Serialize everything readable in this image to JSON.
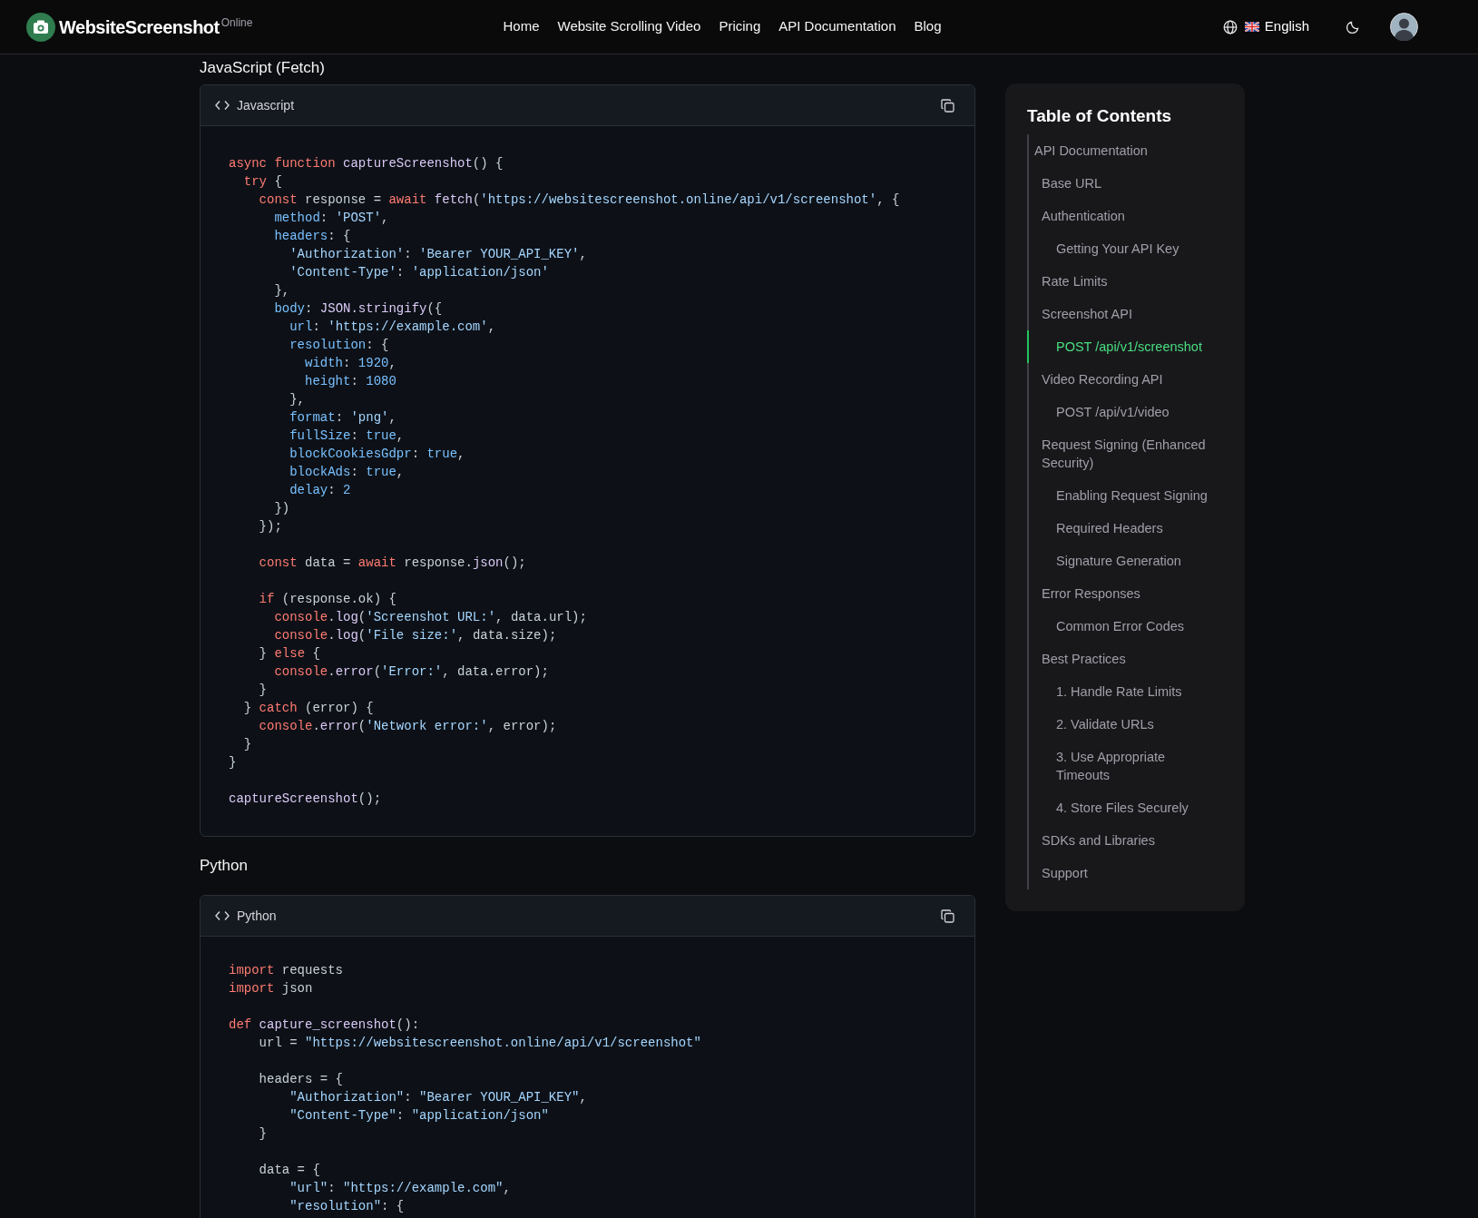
{
  "header": {
    "logo": {
      "name": "WebsiteScreenshot",
      "suffix": "Online"
    },
    "nav": [
      "Home",
      "Website Scrolling Video",
      "Pricing",
      "API Documentation",
      "Blog"
    ],
    "language": "English"
  },
  "sections": [
    {
      "heading": "JavaScript (Fetch)",
      "language": "Javascript",
      "lines": [
        {
          "kind": "code",
          "tokens": [
            {
              "kind": "keyword",
              "text": "async function "
            },
            {
              "kind": "function",
              "text": "captureScreenshot"
            },
            {
              "kind": "plain",
              "text": "() {"
            }
          ]
        },
        {
          "kind": "code",
          "tokens": [
            {
              "kind": "keyword",
              "text": "  try "
            },
            {
              "kind": "plain",
              "text": "{"
            }
          ]
        },
        {
          "kind": "code",
          "tokens": [
            {
              "kind": "keyword",
              "text": "    const "
            },
            {
              "kind": "plain",
              "text": "response = "
            },
            {
              "kind": "keyword",
              "text": "await "
            },
            {
              "kind": "function",
              "text": "fetch"
            },
            {
              "kind": "plain",
              "text": "("
            },
            {
              "kind": "string",
              "text": "'https://websitescreenshot.online/api/v1/screenshot'"
            },
            {
              "kind": "plain",
              "text": ", {"
            }
          ]
        },
        {
          "kind": "code",
          "tokens": [
            {
              "kind": "property",
              "text": "      method"
            },
            {
              "kind": "plain",
              "text": ": "
            },
            {
              "kind": "string",
              "text": "'POST'"
            },
            {
              "kind": "plain",
              "text": ","
            }
          ]
        },
        {
          "kind": "code",
          "tokens": [
            {
              "kind": "property",
              "text": "      headers"
            },
            {
              "kind": "plain",
              "text": ": {"
            }
          ]
        },
        {
          "kind": "code",
          "tokens": [
            {
              "kind": "string",
              "text": "        'Authorization'"
            },
            {
              "kind": "plain",
              "text": ": "
            },
            {
              "kind": "string",
              "text": "'Bearer YOUR_API_KEY'"
            },
            {
              "kind": "plain",
              "text": ","
            }
          ]
        },
        {
          "kind": "code",
          "tokens": [
            {
              "kind": "string",
              "text": "        'Content-Type'"
            },
            {
              "kind": "plain",
              "text": ": "
            },
            {
              "kind": "string",
              "text": "'application/json'"
            }
          ]
        },
        {
          "kind": "code",
          "tokens": [
            {
              "kind": "plain",
              "text": "      },"
            }
          ]
        },
        {
          "kind": "code",
          "tokens": [
            {
              "kind": "property",
              "text": "      body"
            },
            {
              "kind": "plain",
              "text": ": "
            },
            {
              "kind": "function",
              "text": "JSON.stringify"
            },
            {
              "kind": "plain",
              "text": "({"
            }
          ]
        },
        {
          "kind": "code",
          "tokens": [
            {
              "kind": "property",
              "text": "        url"
            },
            {
              "kind": "plain",
              "text": ": "
            },
            {
              "kind": "string",
              "text": "'https://example.com'"
            },
            {
              "kind": "plain",
              "text": ","
            }
          ]
        },
        {
          "kind": "code",
          "tokens": [
            {
              "kind": "property",
              "text": "        resolution"
            },
            {
              "kind": "plain",
              "text": ": {"
            }
          ]
        },
        {
          "kind": "code",
          "tokens": [
            {
              "kind": "property",
              "text": "          width"
            },
            {
              "kind": "plain",
              "text": ": "
            },
            {
              "kind": "number",
              "text": "1920"
            },
            {
              "kind": "plain",
              "text": ","
            }
          ]
        },
        {
          "kind": "code",
          "tokens": [
            {
              "kind": "property",
              "text": "          height"
            },
            {
              "kind": "plain",
              "text": ": "
            },
            {
              "kind": "number",
              "text": "1080"
            }
          ]
        },
        {
          "kind": "code",
          "tokens": [
            {
              "kind": "plain",
              "text": "        },"
            }
          ]
        },
        {
          "kind": "code",
          "tokens": [
            {
              "kind": "property",
              "text": "        format"
            },
            {
              "kind": "plain",
              "text": ": "
            },
            {
              "kind": "string",
              "text": "'png'"
            },
            {
              "kind": "plain",
              "text": ","
            }
          ]
        },
        {
          "kind": "code",
          "tokens": [
            {
              "kind": "property",
              "text": "        fullSize"
            },
            {
              "kind": "plain",
              "text": ": "
            },
            {
              "kind": "number",
              "text": "true"
            },
            {
              "kind": "plain",
              "text": ","
            }
          ]
        },
        {
          "kind": "code",
          "tokens": [
            {
              "kind": "property",
              "text": "        blockCookiesGdpr"
            },
            {
              "kind": "plain",
              "text": ": "
            },
            {
              "kind": "number",
              "text": "true"
            },
            {
              "kind": "plain",
              "text": ","
            }
          ]
        },
        {
          "kind": "code",
          "tokens": [
            {
              "kind": "property",
              "text": "        blockAds"
            },
            {
              "kind": "plain",
              "text": ": "
            },
            {
              "kind": "number",
              "text": "true"
            },
            {
              "kind": "plain",
              "text": ","
            }
          ]
        },
        {
          "kind": "code",
          "tokens": [
            {
              "kind": "property",
              "text": "        delay"
            },
            {
              "kind": "plain",
              "text": ": "
            },
            {
              "kind": "number",
              "text": "2"
            }
          ]
        },
        {
          "kind": "code",
          "tokens": [
            {
              "kind": "plain",
              "text": "      })"
            }
          ]
        },
        {
          "kind": "code",
          "tokens": [
            {
              "kind": "plain",
              "text": "    });"
            }
          ]
        },
        {
          "kind": "blank"
        },
        {
          "kind": "code",
          "tokens": [
            {
              "kind": "keyword",
              "text": "    const "
            },
            {
              "kind": "plain",
              "text": "data = "
            },
            {
              "kind": "keyword",
              "text": "await "
            },
            {
              "kind": "plain",
              "text": "response."
            },
            {
              "kind": "function",
              "text": "json"
            },
            {
              "kind": "plain",
              "text": "();"
            }
          ]
        },
        {
          "kind": "blank"
        },
        {
          "kind": "code",
          "tokens": [
            {
              "kind": "keyword",
              "text": "    if "
            },
            {
              "kind": "plain",
              "text": "(response.ok) {"
            }
          ]
        },
        {
          "kind": "code",
          "tokens": [
            {
              "kind": "keyword",
              "text": "      console"
            },
            {
              "kind": "plain",
              "text": "."
            },
            {
              "kind": "function",
              "text": "log"
            },
            {
              "kind": "plain",
              "text": "("
            },
            {
              "kind": "string",
              "text": "'Screenshot URL:'"
            },
            {
              "kind": "plain",
              "text": ", data.url);"
            }
          ]
        },
        {
          "kind": "code",
          "tokens": [
            {
              "kind": "keyword",
              "text": "      console"
            },
            {
              "kind": "plain",
              "text": "."
            },
            {
              "kind": "function",
              "text": "log"
            },
            {
              "kind": "plain",
              "text": "("
            },
            {
              "kind": "string",
              "text": "'File size:'"
            },
            {
              "kind": "plain",
              "text": ", data.size);"
            }
          ]
        },
        {
          "kind": "code",
          "tokens": [
            {
              "kind": "plain",
              "text": "    } "
            },
            {
              "kind": "keyword",
              "text": "else "
            },
            {
              "kind": "plain",
              "text": "{"
            }
          ]
        },
        {
          "kind": "code",
          "tokens": [
            {
              "kind": "keyword",
              "text": "      console"
            },
            {
              "kind": "plain",
              "text": "."
            },
            {
              "kind": "function",
              "text": "error"
            },
            {
              "kind": "plain",
              "text": "("
            },
            {
              "kind": "string",
              "text": "'Error:'"
            },
            {
              "kind": "plain",
              "text": ", data.error);"
            }
          ]
        },
        {
          "kind": "code",
          "tokens": [
            {
              "kind": "plain",
              "text": "    }"
            }
          ]
        },
        {
          "kind": "code",
          "tokens": [
            {
              "kind": "plain",
              "text": "  } "
            },
            {
              "kind": "keyword",
              "text": "catch "
            },
            {
              "kind": "plain",
              "text": "(error) {"
            }
          ]
        },
        {
          "kind": "code",
          "tokens": [
            {
              "kind": "keyword",
              "text": "    console"
            },
            {
              "kind": "plain",
              "text": "."
            },
            {
              "kind": "function",
              "text": "error"
            },
            {
              "kind": "plain",
              "text": "("
            },
            {
              "kind": "string",
              "text": "'Network error:'"
            },
            {
              "kind": "plain",
              "text": ", error);"
            }
          ]
        },
        {
          "kind": "code",
          "tokens": [
            {
              "kind": "plain",
              "text": "  }"
            }
          ]
        },
        {
          "kind": "code",
          "tokens": [
            {
              "kind": "plain",
              "text": "}"
            }
          ]
        },
        {
          "kind": "blank"
        },
        {
          "kind": "code",
          "tokens": [
            {
              "kind": "function",
              "text": "captureScreenshot"
            },
            {
              "kind": "plain",
              "text": "();"
            }
          ]
        }
      ]
    },
    {
      "heading": "Python",
      "language": "Python",
      "lines": [
        {
          "kind": "code",
          "tokens": [
            {
              "kind": "keyword",
              "text": "import "
            },
            {
              "kind": "plain",
              "text": "requests"
            }
          ]
        },
        {
          "kind": "code",
          "tokens": [
            {
              "kind": "keyword",
              "text": "import "
            },
            {
              "kind": "plain",
              "text": "json"
            }
          ]
        },
        {
          "kind": "blank"
        },
        {
          "kind": "code",
          "tokens": [
            {
              "kind": "keyword",
              "text": "def "
            },
            {
              "kind": "function",
              "text": "capture_screenshot"
            },
            {
              "kind": "plain",
              "text": "():"
            }
          ]
        },
        {
          "kind": "code",
          "tokens": [
            {
              "kind": "plain",
              "text": "    url = "
            },
            {
              "kind": "string",
              "text": "\"https://websitescreenshot.online/api/v1/screenshot\""
            }
          ]
        },
        {
          "kind": "blank"
        },
        {
          "kind": "code",
          "tokens": [
            {
              "kind": "plain",
              "text": "    headers = {"
            }
          ]
        },
        {
          "kind": "code",
          "tokens": [
            {
              "kind": "string",
              "text": "        \"Authorization\""
            },
            {
              "kind": "plain",
              "text": ": "
            },
            {
              "kind": "string",
              "text": "\"Bearer YOUR_API_KEY\""
            },
            {
              "kind": "plain",
              "text": ","
            }
          ]
        },
        {
          "kind": "code",
          "tokens": [
            {
              "kind": "string",
              "text": "        \"Content-Type\""
            },
            {
              "kind": "plain",
              "text": ": "
            },
            {
              "kind": "string",
              "text": "\"application/json\""
            }
          ]
        },
        {
          "kind": "code",
          "tokens": [
            {
              "kind": "plain",
              "text": "    }"
            }
          ]
        },
        {
          "kind": "blank"
        },
        {
          "kind": "code",
          "tokens": [
            {
              "kind": "plain",
              "text": "    data = {"
            }
          ]
        },
        {
          "kind": "code",
          "tokens": [
            {
              "kind": "string",
              "text": "        \"url\""
            },
            {
              "kind": "plain",
              "text": ": "
            },
            {
              "kind": "string",
              "text": "\"https://example.com\""
            },
            {
              "kind": "plain",
              "text": ","
            }
          ]
        },
        {
          "kind": "code",
          "tokens": [
            {
              "kind": "string",
              "text": "        \"resolution\""
            },
            {
              "kind": "plain",
              "text": ": {"
            }
          ]
        }
      ]
    }
  ],
  "toc": {
    "title": "Table of Contents",
    "items": [
      {
        "label": "API Documentation",
        "selected": false,
        "children": [
          {
            "label": "Base URL",
            "selected": false
          },
          {
            "label": "Authentication",
            "selected": false,
            "children": [
              {
                "label": "Getting Your API Key",
                "selected": false
              }
            ]
          },
          {
            "label": "Rate Limits",
            "selected": false
          },
          {
            "label": "Screenshot API",
            "selected": false,
            "children": [
              {
                "label": "POST /api/v1/screenshot",
                "selected": true
              }
            ]
          },
          {
            "label": "Video Recording API",
            "selected": false,
            "children": [
              {
                "label": "POST /api/v1/video",
                "selected": false
              }
            ]
          },
          {
            "label": "Request Signing (Enhanced Security)",
            "selected": false,
            "children": [
              {
                "label": "Enabling Request Signing",
                "selected": false
              },
              {
                "label": "Required Headers",
                "selected": false
              },
              {
                "label": "Signature Generation",
                "selected": false
              }
            ]
          },
          {
            "label": "Error Responses",
            "selected": false,
            "children": [
              {
                "label": "Common Error Codes",
                "selected": false
              }
            ]
          },
          {
            "label": "Best Practices",
            "selected": false,
            "children": [
              {
                "label": "1. Handle Rate Limits",
                "selected": false
              },
              {
                "label": "2. Validate URLs",
                "selected": false
              },
              {
                "label": "3. Use Appropriate Timeouts",
                "selected": false
              },
              {
                "label": "4. Store Files Securely",
                "selected": false
              }
            ]
          },
          {
            "label": "SDKs and Libraries",
            "selected": false
          },
          {
            "label": "Support",
            "selected": false
          }
        ]
      }
    ]
  }
}
